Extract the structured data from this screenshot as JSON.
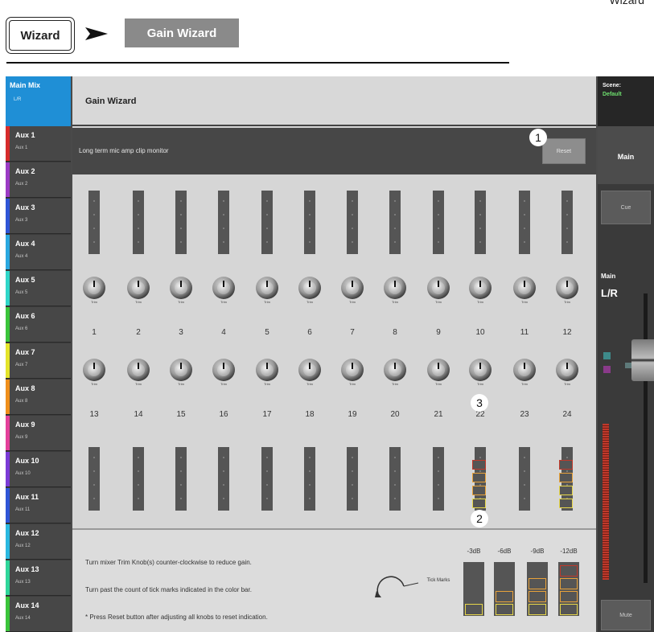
{
  "header": {
    "corner_label": "Wizard",
    "crumb_root": "Wizard",
    "crumb_current": "Gain Wizard"
  },
  "sidebar": {
    "main": {
      "label": "Main Mix",
      "sub": "L/R",
      "color": "#1f8fd6"
    },
    "items": [
      {
        "label": "Aux 1",
        "sub": "Aux 1",
        "color": "#d62b2b"
      },
      {
        "label": "Aux 2",
        "sub": "Aux 2",
        "color": "#9b3bc4"
      },
      {
        "label": "Aux 3",
        "sub": "Aux 3",
        "color": "#2f55d6"
      },
      {
        "label": "Aux 4",
        "sub": "Aux 4",
        "color": "#2aa8e0"
      },
      {
        "label": "Aux 5",
        "sub": "Aux 5",
        "color": "#2fd6c8"
      },
      {
        "label": "Aux 6",
        "sub": "Aux 6",
        "color": "#3bc43b"
      },
      {
        "label": "Aux 7",
        "sub": "Aux 7",
        "color": "#e4e42a"
      },
      {
        "label": "Aux 8",
        "sub": "Aux 8",
        "color": "#ef8f1c"
      },
      {
        "label": "Aux 9",
        "sub": "Aux 9",
        "color": "#e4409a"
      },
      {
        "label": "Aux 10",
        "sub": "Aux 10",
        "color": "#7b3bd6"
      },
      {
        "label": "Aux 11",
        "sub": "Aux 11",
        "color": "#2f55d6"
      },
      {
        "label": "Aux 12",
        "sub": "Aux 12",
        "color": "#2ab8e0"
      },
      {
        "label": "Aux 13",
        "sub": "Aux 13",
        "color": "#2fd69a"
      },
      {
        "label": "Aux 14",
        "sub": "Aux 14",
        "color": "#3bc43b"
      }
    ]
  },
  "content": {
    "title": "Gain Wizard",
    "monitor_text": "Long term mic amp clip monitor",
    "reset_label": "Reset",
    "knob_label": "Trim",
    "row1_channels": [
      "1",
      "2",
      "3",
      "4",
      "5",
      "6",
      "7",
      "8",
      "9",
      "10",
      "11",
      "12"
    ],
    "row2_channels": [
      "13",
      "14",
      "15",
      "16",
      "17",
      "18",
      "19",
      "20",
      "21",
      "22",
      "23",
      "24"
    ],
    "instructions": {
      "line1": "Turn mixer Trim Knob(s) counter-clockwise to reduce gain.",
      "line2": "Turn past the count of tick marks indicated in the color bar.",
      "line3": "* Press Reset button after adjusting all knobs to reset indication.",
      "tick_marks_label": "Tick Marks"
    },
    "legend": [
      "-3dB",
      "-6dB",
      "-9dB",
      "-12dB"
    ]
  },
  "right_panel": {
    "scene_label": "Scene:",
    "scene_value": "Default",
    "main_tab": "Main",
    "cue_label": "Cue",
    "strip_label": "Main",
    "strip_sub": "L/R",
    "mute_label": "Mute"
  },
  "callouts": [
    "1",
    "2",
    "3"
  ],
  "colors": {
    "accent_blue": "#1f8fd6",
    "clip_red": "#c0392b",
    "tick_orange": "#e8a23a",
    "tick_yellow": "#e6d64a",
    "scene_green": "#6ee06e"
  }
}
